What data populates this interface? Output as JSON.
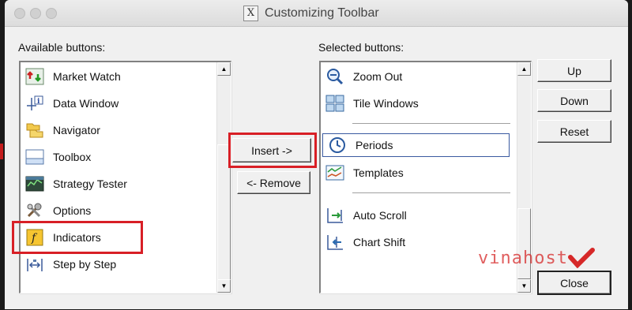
{
  "window": {
    "title": "Customizing Toolbar"
  },
  "available": {
    "label": "Available buttons:",
    "items": [
      {
        "label": "Market Watch",
        "icon": "market-watch-icon"
      },
      {
        "label": "Data Window",
        "icon": "data-window-icon"
      },
      {
        "label": "Navigator",
        "icon": "navigator-icon"
      },
      {
        "label": "Toolbox",
        "icon": "toolbox-icon"
      },
      {
        "label": "Strategy Tester",
        "icon": "strategy-tester-icon"
      },
      {
        "label": "Options",
        "icon": "options-icon"
      },
      {
        "label": "Indicators",
        "icon": "indicators-icon"
      },
      {
        "label": "Step by Step",
        "icon": "step-by-step-icon"
      }
    ]
  },
  "selected": {
    "label": "Selected buttons:",
    "items": [
      {
        "label": "Zoom Out",
        "icon": "zoom-out-icon"
      },
      {
        "label": "Tile Windows",
        "icon": "tile-windows-icon"
      },
      {
        "label": "Periods",
        "icon": "periods-icon",
        "focused": true
      },
      {
        "label": "Templates",
        "icon": "templates-icon"
      },
      {
        "label": "Auto Scroll",
        "icon": "auto-scroll-icon"
      },
      {
        "label": "Chart Shift",
        "icon": "chart-shift-icon"
      }
    ]
  },
  "buttons": {
    "insert": "Insert ->",
    "remove": "<- Remove",
    "up": "Up",
    "down": "Down",
    "reset": "Reset",
    "close": "Close"
  },
  "watermark": {
    "text": "vinahost"
  },
  "colors": {
    "highlight": "#d81f26",
    "window_bg": "#f0f0f0"
  }
}
